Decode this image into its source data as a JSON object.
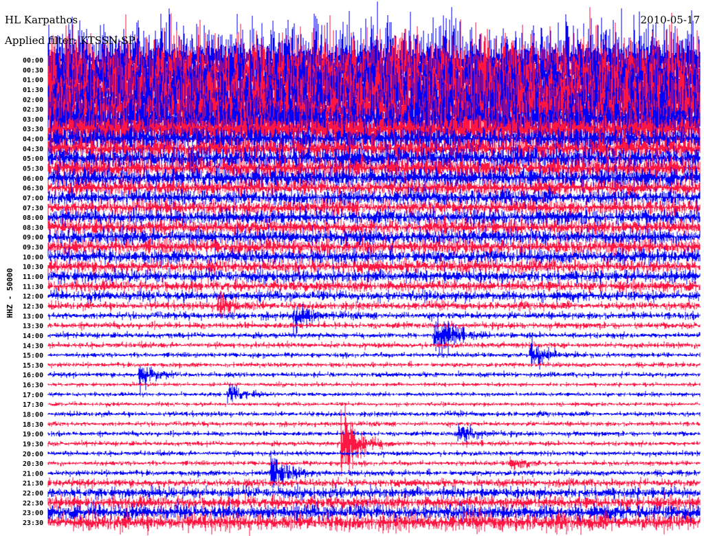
{
  "header": {
    "station": "HL Karpathos",
    "filter": "Applied filter: KTSSN-SP",
    "date": "2010-05-17",
    "channel": "HHZ - 50000"
  },
  "chart_data": {
    "type": "line",
    "title": "HL Karpathos 2010-05-17",
    "ylabel": "HHZ - 50000",
    "x_unit": "minutes within trace",
    "xlim": [
      0,
      30
    ],
    "colors": {
      "even": "#0000ff",
      "odd": "#ff1744"
    },
    "tick_labels": [
      "00:00",
      "00:30",
      "01:00",
      "01:30",
      "02:00",
      "02:30",
      "03:00",
      "03:30",
      "04:00",
      "04:30",
      "05:00",
      "05:30",
      "06:00",
      "06:30",
      "07:00",
      "07:30",
      "08:00",
      "08:30",
      "09:00",
      "09:30",
      "10:00",
      "10:30",
      "11:00",
      "11:30",
      "12:00",
      "12:30",
      "13:00",
      "13:30",
      "14:00",
      "14:30",
      "15:00",
      "15:30",
      "16:00",
      "16:30",
      "17:00",
      "17:30",
      "18:00",
      "18:30",
      "19:00",
      "19:30",
      "20:00",
      "20:30",
      "21:00",
      "21:30",
      "22:00",
      "22:30",
      "23:00",
      "23:30"
    ],
    "noise_level": [
      9,
      9,
      9,
      9,
      9,
      9,
      8,
      5,
      3,
      3,
      3,
      3,
      2.6,
      2.2,
      2,
      2,
      2,
      2,
      2,
      2,
      1.8,
      1.7,
      1.6,
      1.4,
      1.3,
      1,
      0.9,
      0.8,
      0.7,
      0.7,
      0.6,
      0.6,
      0.6,
      0.5,
      0.5,
      0.5,
      0.6,
      0.6,
      0.6,
      0.6,
      0.6,
      0.6,
      0.7,
      1,
      1.4,
      1.6,
      2,
      2.2
    ],
    "events": [
      {
        "trace": 28,
        "minute": 17.8,
        "amp": 8
      },
      {
        "trace": 30,
        "minute": 22.2,
        "amp": 5
      },
      {
        "trace": 32,
        "minute": 4.2,
        "amp": 4
      },
      {
        "trace": 34,
        "minute": 8.3,
        "amp": 3
      },
      {
        "trace": 38,
        "minute": 18.9,
        "amp": 3
      },
      {
        "trace": 39,
        "minute": 13.5,
        "amp": 14
      },
      {
        "trace": 42,
        "minute": 10.3,
        "amp": 6
      },
      {
        "trace": 41,
        "minute": 21.3,
        "amp": 2
      },
      {
        "trace": 26,
        "minute": 11.3,
        "amp": 4
      },
      {
        "trace": 25,
        "minute": 7.8,
        "amp": 4
      }
    ]
  }
}
